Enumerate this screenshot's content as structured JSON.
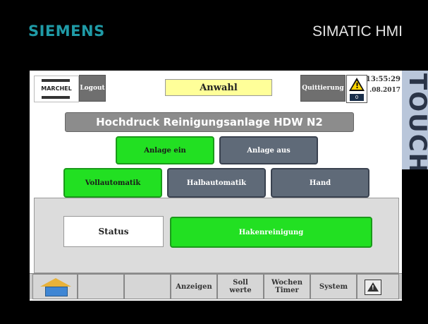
{
  "bezel": {
    "brand": "SIEMENS",
    "model": "SIMATIC HMI",
    "touch_label": "TOUCH"
  },
  "header": {
    "logo_text": "MARCHEL",
    "logout_label": "Logout",
    "selection_label": "Anwahl",
    "acknowledge_label": "Quittierung",
    "alarm_count": "0",
    "time": "13:55:29",
    "date": ".08.2017"
  },
  "main": {
    "title": "Hochdruck Reinigungsanlage HDW N2",
    "plant_on_label": "Anlage ein",
    "plant_off_label": "Anlage aus",
    "modes": {
      "full_auto": "Vollautomatik",
      "semi_auto": "Halbautomatik",
      "manual": "Hand"
    },
    "status_label": "Status",
    "status_value": "Hakenreinigung"
  },
  "navbar": {
    "items": [
      "Anzeigen",
      "Soll\nwerte",
      "Wochen\nTimer",
      "System"
    ],
    "display_label": "Anzeigen",
    "setpoints_line1": "Soll",
    "setpoints_line2": "werte",
    "timer_line1": "Wochen",
    "timer_line2": "Timer",
    "system_label": "System"
  },
  "colors": {
    "active_green": "#22e022",
    "inactive_slate": "#5f6a78",
    "siemens_teal": "#1f9aa6",
    "selection_yellow": "#ffff99"
  }
}
